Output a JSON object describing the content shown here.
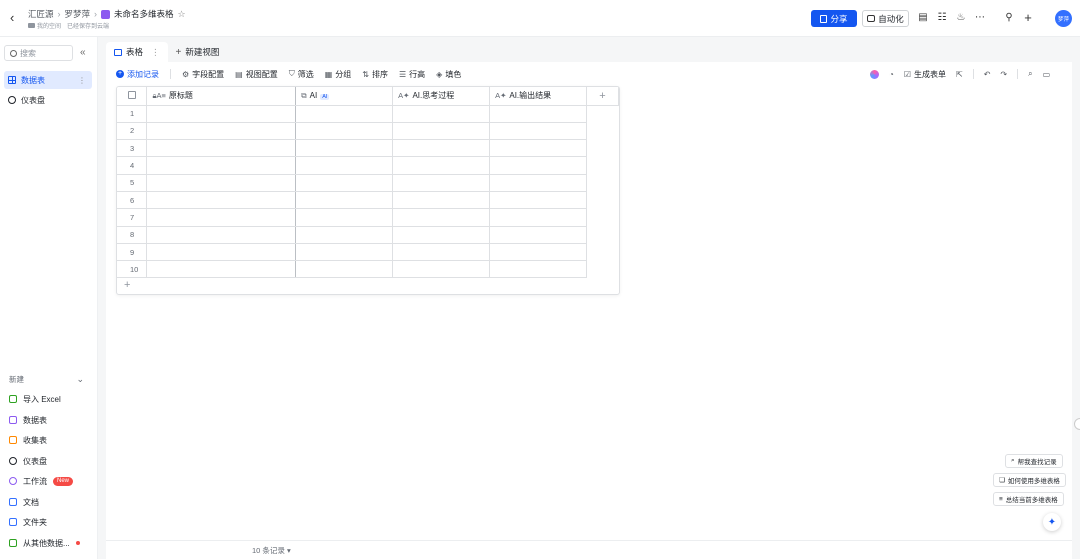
{
  "header": {
    "breadcrumb": [
      "汇匠源",
      "罗梦萍"
    ],
    "doc_title": "未命名多维表格",
    "location": "我的空间",
    "save_status": "已经保存到云端",
    "share_label": "分享",
    "automation_label": "自动化",
    "avatar_text": "梦萍"
  },
  "sidebar": {
    "search_placeholder": "搜索",
    "items": [
      {
        "label": "数据表",
        "active": true
      },
      {
        "label": "仪表盘",
        "active": false
      }
    ],
    "new_section": {
      "title": "新建",
      "items": [
        {
          "label": "导入 Excel",
          "color": "#2ea121"
        },
        {
          "label": "数据表",
          "color": "#8c5bf0"
        },
        {
          "label": "收集表",
          "color": "#ff8800"
        },
        {
          "label": "仪表盘",
          "color": "#1f2329"
        },
        {
          "label": "工作流",
          "color": "#8c5bf0",
          "badge": "New"
        },
        {
          "label": "文档",
          "color": "#3370ff"
        },
        {
          "label": "文件夹",
          "color": "#3370ff"
        },
        {
          "label": "从其他数据...",
          "color": "#2ea121"
        }
      ]
    }
  },
  "tabs": [
    {
      "label": "表格",
      "active": true
    },
    {
      "label": "新建视图",
      "active": false
    }
  ],
  "toolbar": {
    "add_record": "添加记录",
    "field_config": "字段配置",
    "view_config": "视图配置",
    "filter": "筛选",
    "group": "分组",
    "sort": "排序",
    "row_height": "行高",
    "fill_color": "填色",
    "generate_form": "生成表单"
  },
  "table": {
    "columns": [
      "原标题",
      "AI",
      "AI.思考过程",
      "AI.输出结果"
    ],
    "ai_tag": "AI",
    "rows": [
      "1",
      "2",
      "3",
      "4",
      "5",
      "6",
      "7",
      "8",
      "9",
      "10"
    ]
  },
  "footer": {
    "record_count": "10 条记录"
  },
  "help": {
    "items": [
      "帮我查找记录",
      "如何使用多维表格",
      "总结当前多维表格"
    ]
  },
  "colors": {
    "accent": "#1456f0",
    "active_bg": "#e1eaff"
  }
}
